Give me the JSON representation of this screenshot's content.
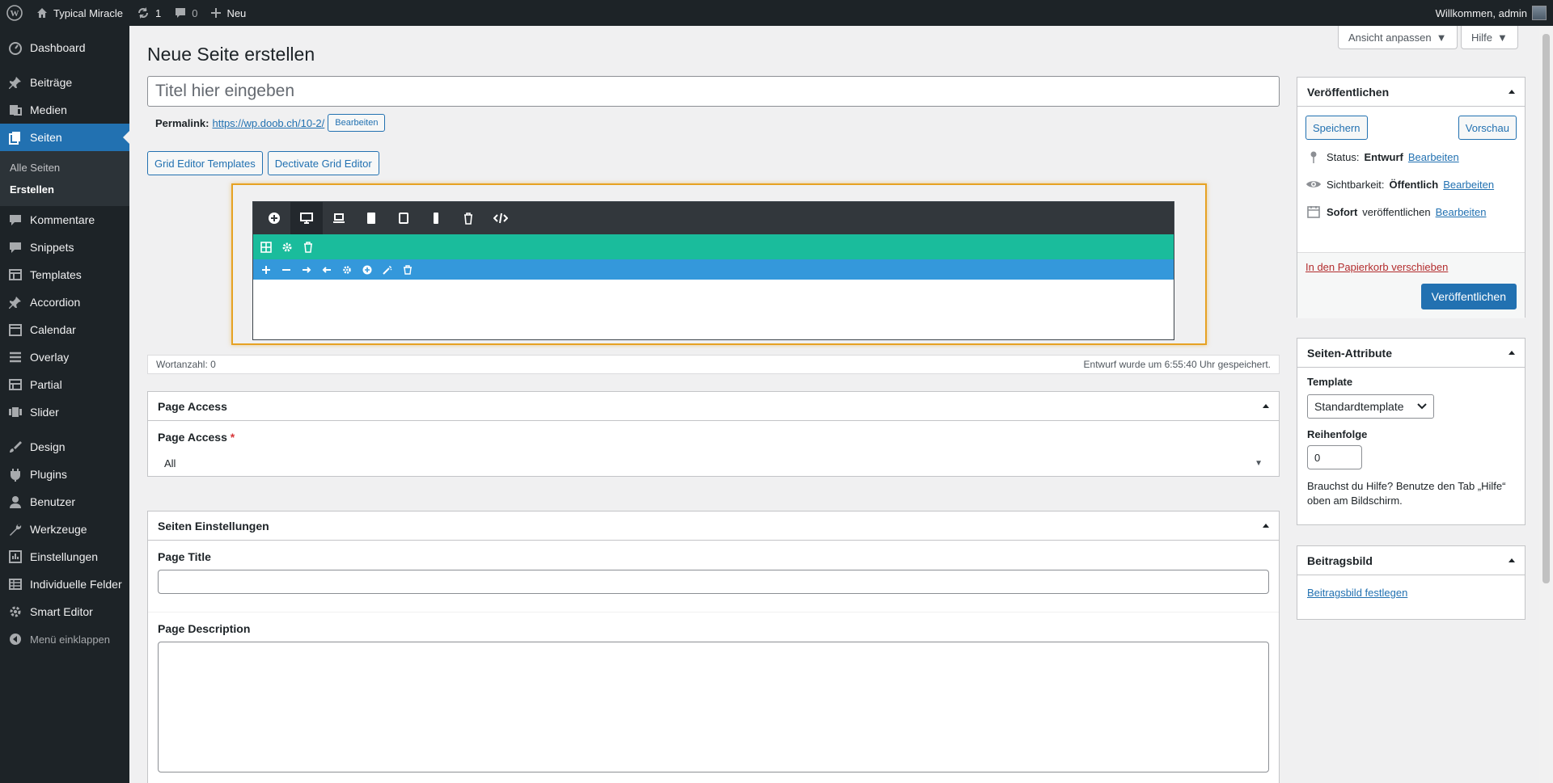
{
  "adminbar": {
    "site_name": "Typical Miracle",
    "updates_count": "1",
    "comments_count": "0",
    "new_label": "Neu",
    "greeting": "Willkommen, admin"
  },
  "sidebar": {
    "items": [
      {
        "label": "Dashboard",
        "icon": "dashboard-icon"
      },
      {
        "label": "Beiträge",
        "icon": "pin-icon"
      },
      {
        "label": "Medien",
        "icon": "media-icon"
      },
      {
        "label": "Seiten",
        "icon": "pages-icon"
      },
      {
        "label": "Kommentare",
        "icon": "comments-icon"
      },
      {
        "label": "Snippets",
        "icon": "snippets-icon"
      },
      {
        "label": "Templates",
        "icon": "templates-icon"
      },
      {
        "label": "Accordion",
        "icon": "pin-icon"
      },
      {
        "label": "Calendar",
        "icon": "calendar-icon"
      },
      {
        "label": "Overlay",
        "icon": "overlay-icon"
      },
      {
        "label": "Partial",
        "icon": "partial-icon"
      },
      {
        "label": "Slider",
        "icon": "slider-icon"
      },
      {
        "label": "Design",
        "icon": "brush-icon"
      },
      {
        "label": "Plugins",
        "icon": "plugin-icon"
      },
      {
        "label": "Benutzer",
        "icon": "user-icon"
      },
      {
        "label": "Werkzeuge",
        "icon": "wrench-icon"
      },
      {
        "label": "Einstellungen",
        "icon": "settings-icon"
      },
      {
        "label": "Individuelle Felder",
        "icon": "fields-icon"
      },
      {
        "label": "Smart Editor",
        "icon": "gear-icon"
      }
    ],
    "submenu": [
      "Alle Seiten",
      "Erstellen"
    ],
    "collapse_label": "Menü einklappen"
  },
  "header": {
    "title": "Neue Seite erstellen",
    "screen_options": "Ansicht anpassen",
    "help": "Hilfe"
  },
  "editor": {
    "title_placeholder": "Titel hier eingeben",
    "permalink_label": "Permalink:",
    "permalink_url": "https://wp.doob.ch/10-2/",
    "permalink_edit": "Bearbeiten",
    "grid_templates_button": "Grid Editor Templates",
    "deactivate_button": "Dectivate Grid Editor",
    "word_count": "Wortanzahl: 0",
    "draft_saved": "Entwurf wurde um 6:55:40 Uhr gespeichert."
  },
  "page_access": {
    "box_title": "Page Access",
    "field_label": "Page Access",
    "required_mark": "*",
    "selected": "All"
  },
  "seiten_einstellungen": {
    "box_title": "Seiten Einstellungen",
    "page_title_label": "Page Title",
    "page_description_label": "Page Description"
  },
  "publish": {
    "box_title": "Veröffentlichen",
    "save_button": "Speichern",
    "preview_button": "Vorschau",
    "status_label": "Status:",
    "status_value": "Entwurf",
    "visibility_label": "Sichtbarkeit:",
    "visibility_value": "Öffentlich",
    "schedule_strong": "Sofort",
    "schedule_text": "veröffentlichen",
    "edit_link": "Bearbeiten",
    "trash_link": "In den Papierkorb verschieben",
    "publish_button": "Veröffentlichen"
  },
  "attributes": {
    "box_title": "Seiten-Attribute",
    "template_label": "Template",
    "template_value": "Standardtemplate",
    "order_label": "Reihenfolge",
    "order_value": "0",
    "help_text": "Brauchst du Hilfe? Benutze den Tab „Hilfe“ oben am Bildschirm."
  },
  "featured_image": {
    "box_title": "Beitragsbild",
    "set_link": "Beitragsbild festlegen"
  },
  "colors": {
    "accent": "#2271b1",
    "adminbar_bg": "#1d2327",
    "grid_toolbar": "#32373c",
    "grid_row": "#1abc9c",
    "grid_col": "#3498db",
    "highlight": "#e6a223"
  }
}
